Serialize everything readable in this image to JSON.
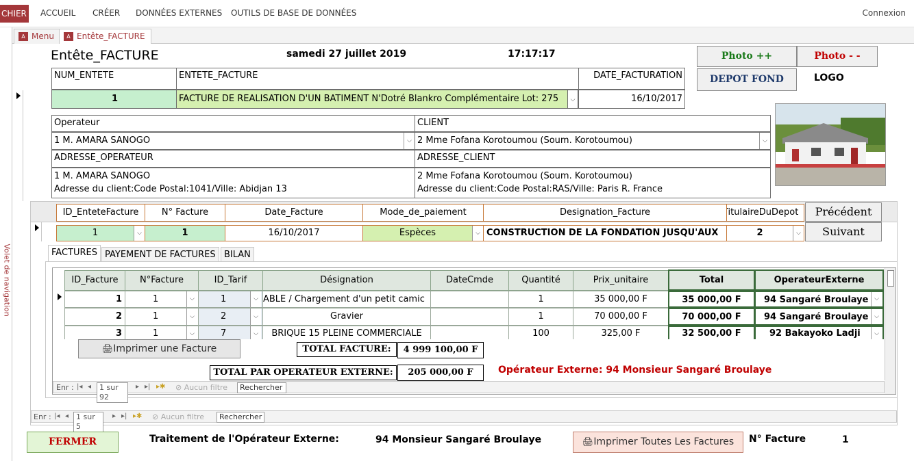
{
  "ribbon": {
    "fichier": "CHIER",
    "tabs": [
      "ACCUEIL",
      "CRÉER",
      "DONNÉES EXTERNES",
      "OUTILS DE BASE DE DONNÉES"
    ],
    "connexion": "Connexion"
  },
  "doc_tabs": [
    "Menu",
    "Entête_FACTURE"
  ],
  "nav_pane_label": "Volet de navigation",
  "header": {
    "form_title": "Entête_FACTURE",
    "date": "samedi 27 juillet 2019",
    "time": "17:17:17",
    "photo_plus": "Photo ++",
    "photo_minus": "Photo - -",
    "depot_fond": "DEPOT FOND",
    "logo": "LOGO"
  },
  "entete": {
    "num_entete_label": "NUM_ENTETE",
    "entete_facture_label": "ENTETE_FACTURE",
    "date_facturation_label": "DATE_FACTURATION",
    "num_entete": "1",
    "entete_facture": "FACTURE DE REALISATION D'UN BATIMENT N'Dotré Blankro Complémentaire Lot: 275",
    "date_facturation": "16/10/2017",
    "operateur_label": "Operateur",
    "client_label": "CLIENT",
    "operateur": "1 M. AMARA SANOGO",
    "client": "2 Mme Fofana Korotoumou (Soum. Korotoumou)",
    "adresse_operateur_label": "ADRESSE_OPERATEUR",
    "adresse_client_label": "ADRESSE_CLIENT",
    "adresse_operateur_l1": "1 M. AMARA SANOGO",
    "adresse_operateur_l2": "Adresse du client:Code Postal:1041/Ville:  Abidjan 13",
    "adresse_client_l1": "2 Mme Fofana Korotoumou (Soum. Korotoumou)",
    "adresse_client_l2": "Adresse du client:Code Postal:RAS/Ville:  Paris R. France"
  },
  "facture_form": {
    "headers": [
      "ID_EnteteFacture",
      "N° Facture",
      "Date_Facture",
      "Mode_de_paiement",
      "Designation_Facture",
      "TitulaireDuDepot"
    ],
    "values": [
      "1",
      "1",
      "16/10/2017",
      "Espèces",
      "CONSTRUCTION DE LA FONDATION JUSQU'AUX",
      "2"
    ],
    "precedent": "Précédent",
    "suivant": "Suivant"
  },
  "subtabs": [
    "FACTURES",
    "PAYEMENT DE FACTURES",
    "BILAN"
  ],
  "grid": {
    "headers": [
      "ID_Facture",
      "N°Facture",
      "ID_Tarif",
      "Désignation",
      "DateCmde",
      "Quantité",
      "Prix_unitaire",
      "Total",
      "OperateurExterne"
    ],
    "rows": [
      [
        "1",
        "1",
        "1",
        "ABLE / Chargement d'un petit camic",
        "",
        "1",
        "35 000,00 F",
        "35 000,00 F",
        "94 Sangaré Broulaye"
      ],
      [
        "2",
        "1",
        "2",
        "Gravier",
        "",
        "1",
        "70 000,00 F",
        "70 000,00 F",
        "94 Sangaré Broulaye"
      ],
      [
        "3",
        "1",
        "7",
        "BRIQUE 15 PLEINE COMMERCIALE",
        "",
        "100",
        "325,00 F",
        "32 500,00 F",
        "92 Bakayoko Ladji"
      ]
    ]
  },
  "totals": {
    "imprimer_facture": "Imprimer une Facture",
    "total_facture_label": "TOTAL FACTURE:",
    "total_facture": "4 999 100,00 F",
    "total_par_op_label": "TOTAL PAR OPERATEUR EXTERNE:",
    "total_par_op": "205 000,00 F",
    "operateur_externe_text": "Opérateur Externe: 94 Monsieur Sangaré Broulaye"
  },
  "inner_nav": {
    "enr": "Enr :",
    "record": "1 sur 92",
    "filter": "Aucun filtre",
    "search": "Rechercher"
  },
  "outer_nav": {
    "enr": "Enr :",
    "record": "1 sur 5",
    "filter": "Aucun filtre",
    "search": "Rechercher"
  },
  "footer": {
    "fermer": "FERMER",
    "traitement_label": "Traitement de l'Opérateur Externe:",
    "traitement_value": "94 Monsieur Sangaré Broulaye",
    "imprimer_toutes": "Imprimer Toutes Les Factures",
    "n_facture_label": "N° Facture",
    "n_facture_value": "1"
  },
  "colors": {
    "access_red": "#a4373a",
    "green_field": "#c6efce",
    "lime_field": "#d5f0b0",
    "photo_plus": "#1a7a1a",
    "photo_minus": "#c00000",
    "operateur_externe": "#c00000"
  },
  "icons": [
    "access-icon",
    "dropdown-arrow-icon",
    "record-selector-icon",
    "printer-icon",
    "house-photo"
  ]
}
